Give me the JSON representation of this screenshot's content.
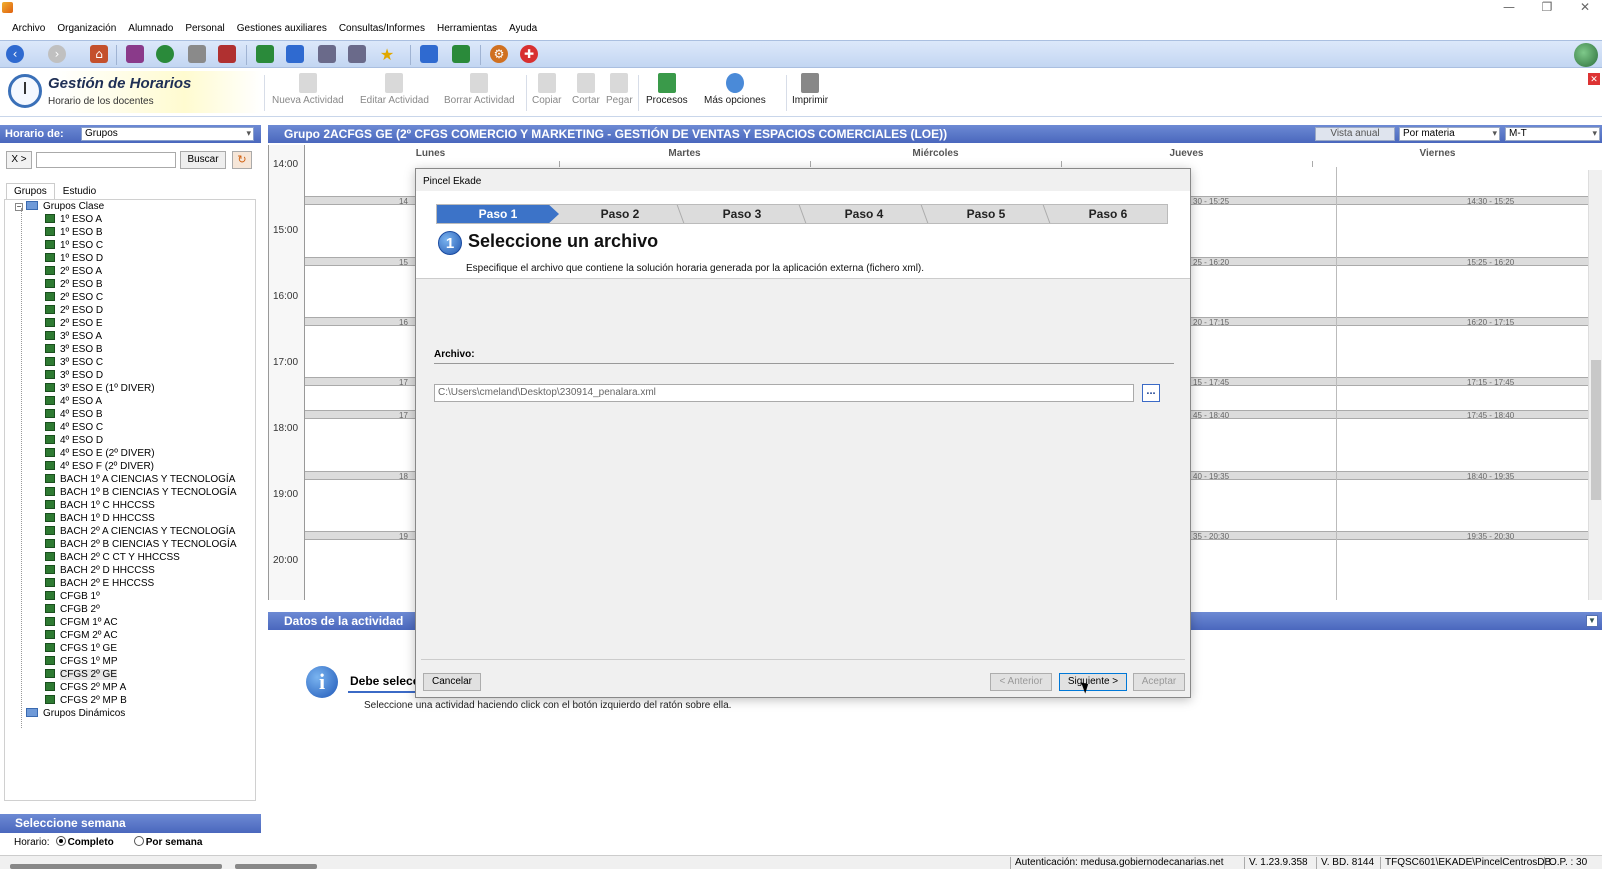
{
  "window": {
    "minimize": "—",
    "restore": "❐",
    "close": "✕"
  },
  "menu": [
    "Archivo",
    "Organización",
    "Alumnado",
    "Personal",
    "Gestiones auxiliares",
    "Consultas/Informes",
    "Herramientas",
    "Ayuda"
  ],
  "brand": {
    "title": "Gestión de Horarios",
    "subtitle": "Horario de los docentes"
  },
  "ribbon": {
    "nueva": "Nueva Actividad",
    "editar": "Editar Actividad",
    "borrar": "Borrar Actividad",
    "copiar": "Copiar",
    "cortar": "Cortar",
    "pegar": "Pegar",
    "procesos": "Procesos",
    "mas": "Más opciones",
    "imprimir": "Imprimir"
  },
  "left": {
    "horario_label": "Horario de:",
    "horario_value": "Grupos",
    "x_label": "X >",
    "buscar": "Buscar",
    "tabs": [
      "Grupos",
      "Estudio"
    ],
    "root": "Grupos Clase",
    "items": [
      "1º ESO A",
      "1º ESO B",
      "1º ESO C",
      "1º ESO D",
      "2º ESO A",
      "2º ESO B",
      "2º ESO C",
      "2º ESO D",
      "2º ESO E",
      "3º ESO A",
      "3º ESO B",
      "3º ESO C",
      "3º ESO D",
      "3º ESO E (1º DIVER)",
      "4º ESO A",
      "4º ESO B",
      "4º ESO C",
      "4º ESO D",
      "4º ESO E (2º DIVER)",
      "4º ESO F (2º DIVER)",
      "BACH 1º A CIENCIAS Y TECNOLOGÍA",
      "BACH 1º B CIENCIAS Y TECNOLOGÍA",
      "BACH 1º C HHCCSS",
      "BACH 1º D HHCCSS",
      "BACH 2º A CIENCIAS Y TECNOLOGÍA",
      "BACH 2º B CIENCIAS Y TECNOLOGÍA",
      "BACH 2º C CT Y HHCCSS",
      "BACH 2º D HHCCSS",
      "BACH 2º E HHCCSS",
      "CFGB 1º",
      "CFGB 2º",
      "CFGM 1º AC",
      "CFGM 2º AC",
      "CFGS 1º GE",
      "CFGS 1º MP",
      "CFGS 2º GE",
      "CFGS 2º MP A",
      "CFGS 2º MP B"
    ],
    "dynamic": "Grupos Dinámicos",
    "week_title": "Seleccione semana",
    "horario_row": "Horario:",
    "completo": "Completo",
    "por_semana": "Por semana"
  },
  "schedule": {
    "group_title": "Grupo 2ACFGS GE  (2º CFGS COMERCIO Y MARKETING - GESTIÓN DE VENTAS Y ESPACIOS COMERCIALES (LOE))",
    "vista_anual": "Vista anual",
    "por_materia": "Por materia",
    "turno": "M-T",
    "days": [
      "Lunes",
      "Martes",
      "Miércoles",
      "Jueves",
      "Viernes"
    ],
    "hours": [
      "14:00",
      "15:00",
      "16:00",
      "17:00",
      "18:00",
      "19:00",
      "20:00"
    ],
    "left_stubs": [
      "14",
      "15",
      "16",
      "17",
      "17",
      "18",
      "19"
    ],
    "jueves_slots": [
      "30 - 15:25",
      "25 - 16:20",
      "20 - 17:15",
      "15 - 17:45",
      "45 - 18:40",
      "40 - 19:35",
      "35 - 20:30"
    ],
    "viernes_slots": [
      "14:30 - 15:25",
      "15:25 - 16:20",
      "16:20 - 17:15",
      "17:15 - 17:45",
      "17:45 - 18:40",
      "18:40 - 19:35",
      "19:35 - 20:30"
    ]
  },
  "datos": {
    "title": "Datos de la actividad",
    "info_title": "Debe selecc",
    "info_text": "Seleccione una actividad haciendo click con el botón izquierdo del ratón sobre ella."
  },
  "status": {
    "auth": "Autenticación: medusa.gobiernodecanarias.net",
    "version": "V. 1.23.9.358",
    "bd": "V. BD. 8144",
    "server": "TFQSC601\\EKADE\\PincelCentrosDB",
    "op": "O.P. : 30"
  },
  "dialog": {
    "title": "Pincel Ekade",
    "steps": [
      "Paso 1",
      "Paso 2",
      "Paso 3",
      "Paso 4",
      "Paso 5",
      "Paso 6"
    ],
    "step_number": "1",
    "heading": "Seleccione un archivo",
    "description": "Especifique el archivo que contiene la solución horaria generada por la aplicación externa (fichero xml).",
    "archivo_label": "Archivo:",
    "file_path": "C:\\Users\\cmeland\\Desktop\\230914_penalara.xml",
    "browse": "...",
    "cancelar": "Cancelar",
    "anterior": "< Anterior",
    "siguiente": "Siguiente >",
    "aceptar": "Aceptar"
  }
}
